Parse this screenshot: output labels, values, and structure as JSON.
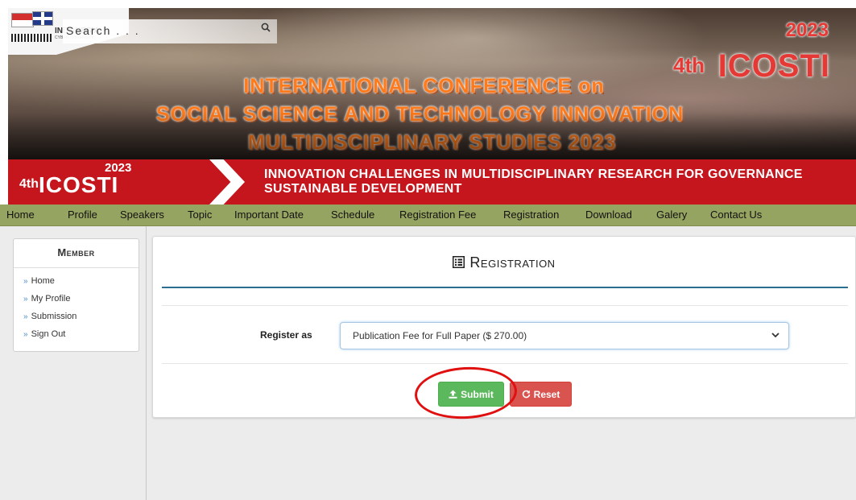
{
  "header": {
    "search": {
      "placeholder": "Search . . ."
    },
    "university": {
      "name": "INDONESIA",
      "sub": "CYBER UNIVERSITY"
    },
    "title_lines": [
      "INTERNATIONAL CONFERENCE on",
      "SOCIAL SCIENCE AND TECHNOLOGY INNOVATION",
      "MULTIDISCIPLINARY STUDIES 2023"
    ],
    "conference_logo": {
      "edition": "4th",
      "name": "ICOSTI",
      "year": "2023"
    },
    "theme_lines": [
      "INNOVATION CHALLENGES IN MULTIDISCIPLINARY RESEARCH FOR GOVERNANCE",
      "SUSTAINABLE DEVELOPMENT"
    ]
  },
  "nav": {
    "items": [
      "Home",
      "Profile",
      "Speakers",
      "Topic",
      "Important Date",
      "Schedule",
      "Registration Fee",
      "Registration",
      "Download",
      "Galery",
      "Contact Us"
    ]
  },
  "sidebar": {
    "title": "Member",
    "items": [
      "Home",
      "My Profile",
      "Submission",
      "Sign Out"
    ]
  },
  "panel": {
    "title": "Registration",
    "form": {
      "register_label": "Register as",
      "register_value": "Publication Fee for Full Paper ($ 270.00)"
    },
    "buttons": {
      "submit": "Submit",
      "reset": "Reset"
    }
  },
  "colors": {
    "nav_bg": "#96a462",
    "theme_red": "#c4161c",
    "accent_teal": "#2a6f8f",
    "submit_green": "#5cb85c",
    "reset_red": "#d9534f",
    "annotation_red": "#e01010"
  },
  "icons": [
    "search-icon",
    "list-icon",
    "upload-icon",
    "refresh-icon",
    "chevron-down-icon",
    "chevron-right-icon"
  ]
}
